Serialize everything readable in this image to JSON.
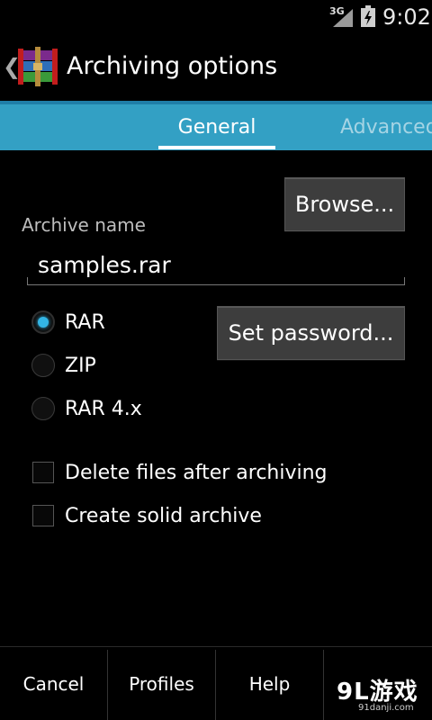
{
  "status_bar": {
    "network": "3G",
    "time": "9:02",
    "icons": [
      "signal-icon",
      "battery-icon"
    ]
  },
  "action_bar": {
    "up_icon": "chevron-left-icon",
    "app_icon": "winrar-books-icon",
    "title": "Archiving options"
  },
  "tabs": [
    {
      "label": "General",
      "selected": true
    },
    {
      "label": "Advanced",
      "selected": false
    }
  ],
  "general": {
    "browse_label": "Browse...",
    "archive_name_label": "Archive name",
    "archive_name_value": "samples.rar",
    "format_options": [
      {
        "label": "RAR",
        "selected": true
      },
      {
        "label": "ZIP",
        "selected": false
      },
      {
        "label": "RAR 4.x",
        "selected": false
      }
    ],
    "set_password_label": "Set password...",
    "checkboxes": [
      {
        "label": "Delete files after archiving",
        "checked": false
      },
      {
        "label": "Create solid archive",
        "checked": false
      }
    ]
  },
  "bottom_bar": {
    "cancel": "Cancel",
    "profiles": "Profiles",
    "help": "Help"
  },
  "watermark": {
    "logo": "9L游戏",
    "url": "91danji.com"
  },
  "colors": {
    "accent": "#33b5e5",
    "tab_bar": "#33a0c4",
    "button": "#3d3d3d"
  }
}
